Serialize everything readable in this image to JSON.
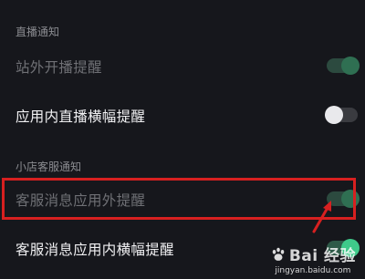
{
  "sections": {
    "live": {
      "header": "直播通知",
      "items": [
        {
          "label": "站外开播提醒",
          "toggle_on": true
        },
        {
          "label": "应用内直播横幅提醒",
          "toggle_on": false
        }
      ]
    },
    "shop": {
      "header": "小店客服通知",
      "items": [
        {
          "label": "客服消息应用外提醒",
          "toggle_on": true
        },
        {
          "label": "客服消息应用内横幅提醒",
          "toggle_on": true
        }
      ]
    }
  },
  "watermark": {
    "logo_text": "Bai 经验",
    "url": "jingyan.baidu.com"
  },
  "colors": {
    "background": "#16171c",
    "toggle_on": "#3fc98a",
    "highlight": "#d72020"
  }
}
